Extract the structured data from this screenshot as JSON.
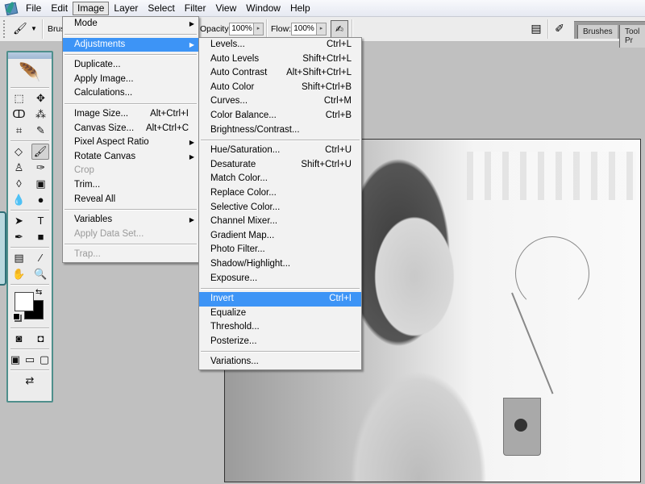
{
  "menubar": {
    "items": [
      "File",
      "Edit",
      "Image",
      "Layer",
      "Select",
      "Filter",
      "View",
      "Window",
      "Help"
    ],
    "open_item": "Image"
  },
  "options_bar": {
    "brush_label": "Brus",
    "opacity_label": "Opacity:",
    "opacity_value": "100%",
    "flow_label": "Flow:",
    "flow_value": "100%",
    "palette_tabs": [
      "Brushes",
      "Tool Pr"
    ]
  },
  "image_menu": {
    "items": [
      {
        "label": "Mode",
        "shortcut": "",
        "submenu": true,
        "disabled": false
      },
      {
        "sep": true
      },
      {
        "label": "Adjustments",
        "shortcut": "",
        "submenu": true,
        "disabled": false,
        "highlighted": true
      },
      {
        "sep": true
      },
      {
        "label": "Duplicate...",
        "shortcut": ""
      },
      {
        "label": "Apply Image...",
        "shortcut": ""
      },
      {
        "label": "Calculations...",
        "shortcut": ""
      },
      {
        "sep": true
      },
      {
        "label": "Image Size...",
        "shortcut": "Alt+Ctrl+I"
      },
      {
        "label": "Canvas Size...",
        "shortcut": "Alt+Ctrl+C"
      },
      {
        "label": "Pixel Aspect Ratio",
        "shortcut": "",
        "submenu": true
      },
      {
        "label": "Rotate Canvas",
        "shortcut": "",
        "submenu": true
      },
      {
        "label": "Crop",
        "shortcut": "",
        "disabled": true
      },
      {
        "label": "Trim...",
        "shortcut": ""
      },
      {
        "label": "Reveal All",
        "shortcut": ""
      },
      {
        "sep": true
      },
      {
        "label": "Variables",
        "shortcut": "",
        "submenu": true
      },
      {
        "label": "Apply Data Set...",
        "shortcut": "",
        "disabled": true
      },
      {
        "sep": true
      },
      {
        "label": "Trap...",
        "shortcut": "",
        "disabled": true
      }
    ]
  },
  "adjustments_menu": {
    "items": [
      {
        "label": "Levels...",
        "shortcut": "Ctrl+L"
      },
      {
        "label": "Auto Levels",
        "shortcut": "Shift+Ctrl+L"
      },
      {
        "label": "Auto Contrast",
        "shortcut": "Alt+Shift+Ctrl+L"
      },
      {
        "label": "Auto Color",
        "shortcut": "Shift+Ctrl+B"
      },
      {
        "label": "Curves...",
        "shortcut": "Ctrl+M"
      },
      {
        "label": "Color Balance...",
        "shortcut": "Ctrl+B"
      },
      {
        "label": "Brightness/Contrast...",
        "shortcut": ""
      },
      {
        "sep": true
      },
      {
        "label": "Hue/Saturation...",
        "shortcut": "Ctrl+U"
      },
      {
        "label": "Desaturate",
        "shortcut": "Shift+Ctrl+U"
      },
      {
        "label": "Match Color...",
        "shortcut": ""
      },
      {
        "label": "Replace Color...",
        "shortcut": ""
      },
      {
        "label": "Selective Color...",
        "shortcut": ""
      },
      {
        "label": "Channel Mixer...",
        "shortcut": ""
      },
      {
        "label": "Gradient Map...",
        "shortcut": ""
      },
      {
        "label": "Photo Filter...",
        "shortcut": ""
      },
      {
        "label": "Shadow/Highlight...",
        "shortcut": ""
      },
      {
        "label": "Exposure...",
        "shortcut": ""
      },
      {
        "sep": true
      },
      {
        "label": "Invert",
        "shortcut": "Ctrl+I",
        "highlighted": true
      },
      {
        "label": "Equalize",
        "shortcut": ""
      },
      {
        "label": "Threshold...",
        "shortcut": ""
      },
      {
        "label": "Posterize...",
        "shortcut": ""
      },
      {
        "sep": true
      },
      {
        "label": "Variations...",
        "shortcut": ""
      }
    ]
  },
  "toolbox": {
    "rows": [
      [
        {
          "name": "marquee-tool-icon",
          "glyph": "⬚"
        },
        {
          "name": "move-tool-icon",
          "glyph": "✥"
        }
      ],
      [
        {
          "name": "lasso-tool-icon",
          "glyph": "ↀ"
        },
        {
          "name": "magic-wand-tool-icon",
          "glyph": "⁂"
        }
      ],
      [
        {
          "name": "crop-tool-icon",
          "glyph": "⌗"
        },
        {
          "name": "slice-tool-icon",
          "glyph": "✎"
        }
      ],
      "sep",
      [
        {
          "name": "healing-brush-tool-icon",
          "glyph": "◇"
        },
        {
          "name": "brush-tool-icon",
          "glyph": "🖌",
          "active": true
        }
      ],
      [
        {
          "name": "clone-stamp-tool-icon",
          "glyph": "♙"
        },
        {
          "name": "history-brush-tool-icon",
          "glyph": "✑"
        }
      ],
      [
        {
          "name": "eraser-tool-icon",
          "glyph": "◊"
        },
        {
          "name": "gradient-tool-icon",
          "glyph": "▣"
        }
      ],
      [
        {
          "name": "blur-tool-icon",
          "glyph": "💧"
        },
        {
          "name": "dodge-tool-icon",
          "glyph": "●"
        }
      ],
      "sep",
      [
        {
          "name": "path-selection-tool-icon",
          "glyph": "➤"
        },
        {
          "name": "type-tool-icon",
          "glyph": "T"
        }
      ],
      [
        {
          "name": "pen-tool-icon",
          "glyph": "✒"
        },
        {
          "name": "shape-tool-icon",
          "glyph": "■"
        }
      ],
      "sep",
      [
        {
          "name": "notes-tool-icon",
          "glyph": "▤"
        },
        {
          "name": "eyedropper-tool-icon",
          "glyph": "⁄"
        }
      ],
      [
        {
          "name": "hand-tool-icon",
          "glyph": "✋"
        },
        {
          "name": "zoom-tool-icon",
          "glyph": "🔍"
        }
      ]
    ],
    "mode_row": [
      {
        "name": "standard-mode-icon",
        "glyph": "◙"
      },
      {
        "name": "quick-mask-mode-icon",
        "glyph": "◘"
      }
    ],
    "screen_row": [
      {
        "name": "standard-screen-icon",
        "glyph": "▣"
      },
      {
        "name": "full-screen-menu-icon",
        "glyph": "▭"
      },
      {
        "name": "full-screen-icon",
        "glyph": "▢"
      }
    ],
    "jump_row": [
      {
        "name": "jump-to-imageready-icon",
        "glyph": "⇄"
      }
    ],
    "foreground_color": "#ffffff",
    "background_color": "#000000"
  },
  "document": {
    "content": "grayscale photo of a woman at a cafe table with a drink"
  }
}
